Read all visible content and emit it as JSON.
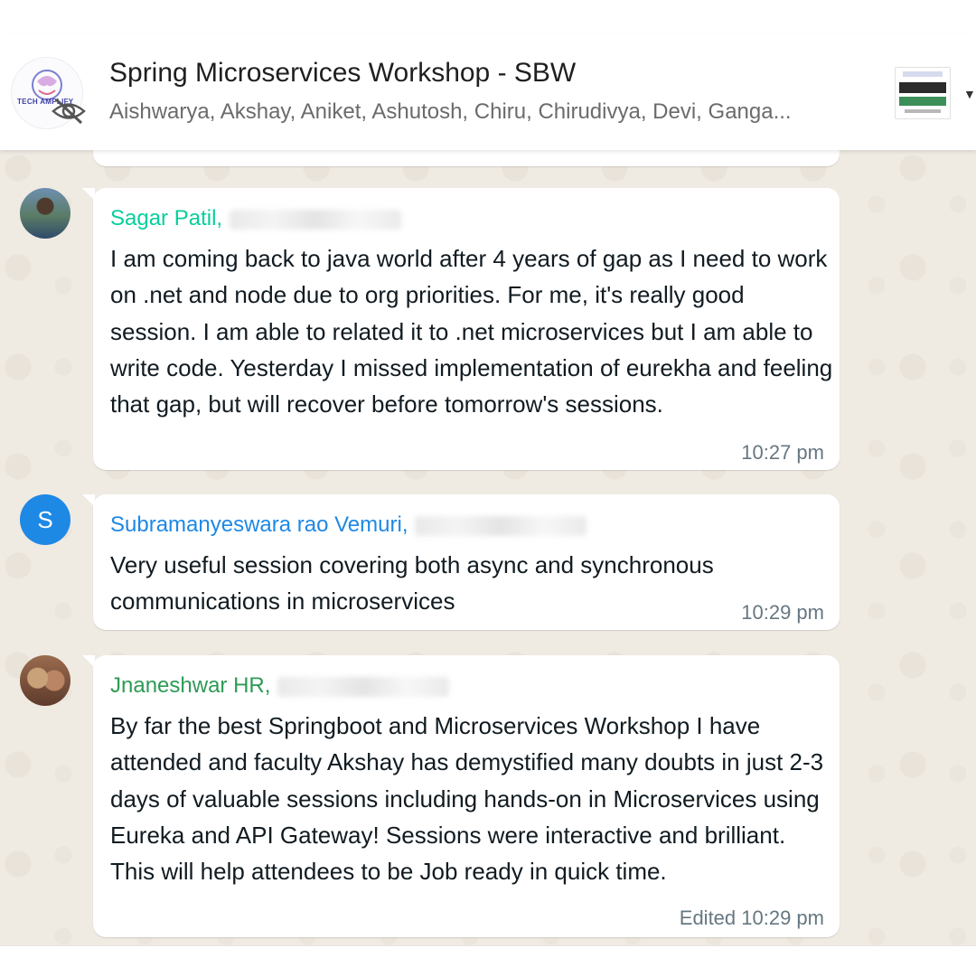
{
  "header": {
    "group_avatar_text": "TECH AMPLIFY",
    "title": "Spring Microservices Workshop - SBW",
    "members": "Aishwarya, Akshay, Aniket, Ashutosh, Chiru, Chirudivya, Devi, Ganga..."
  },
  "messages": [
    {
      "sender": "Sagar Patil,",
      "sender_color": "#06cf9c",
      "text": "I am coming back to java world  after 4 years of gap as I need to work on .net and node due to org priorities. For me, it's really good session. I am able to related it to .net microservices but I am able to write code. Yesterday I missed implementation of eurekha and feeling that gap, but will recover before tomorrow's sessions.",
      "time": "10:27 pm"
    },
    {
      "sender": "Subramanyeswara rao Vemuri,",
      "sender_color": "#1e88e5",
      "avatar_letter": "S",
      "text": "Very useful session covering both async and synchronous communications in microservices",
      "time": "10:29 pm"
    },
    {
      "sender": "Jnaneshwar HR,",
      "sender_color": "#2e9a55",
      "text": "By far the best Springboot and Microservices Workshop I have attended and faculty Akshay has demystified many doubts in just 2-3 days of valuable sessions including hands-on in Microservices using Eureka and API Gateway! Sessions were interactive and brilliant. This will help attendees to be Job ready in quick time.",
      "time": "Edited 10:29 pm"
    }
  ],
  "icons": {
    "group_avatar": "group-logo-icon",
    "visibility": "eye-off-icon",
    "dropdown": "caret-down-icon"
  }
}
